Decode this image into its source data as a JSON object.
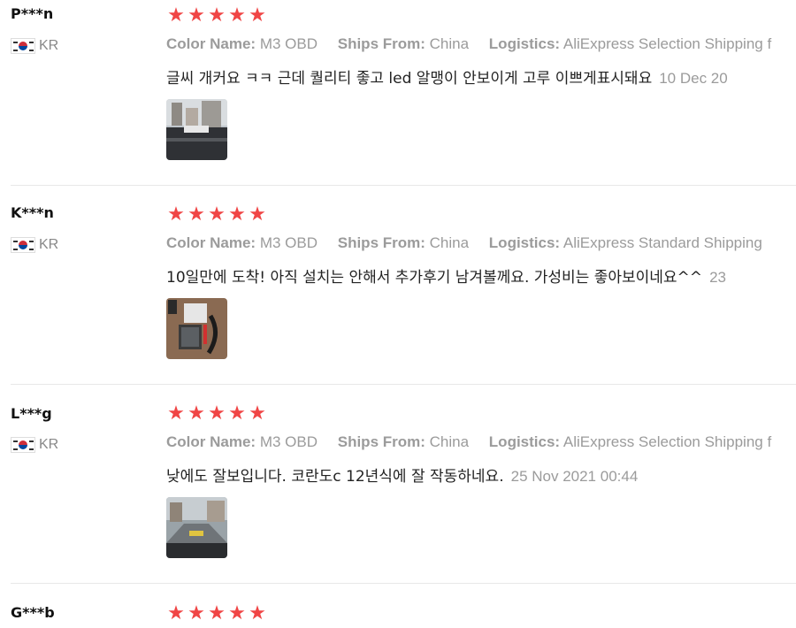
{
  "reviews": [
    {
      "user": "P***n",
      "country": "KR",
      "stars": 5,
      "attrs": [
        {
          "key": "Color Name:",
          "value": "M3 OBD"
        },
        {
          "key": "Ships From:",
          "value": "China"
        },
        {
          "key": "Logistics:",
          "value": "AliExpress Selection Shipping f"
        }
      ],
      "text": "글씨 개커요 ㅋㅋ 근데 퀄리티 좋고 led 알맹이 안보이게 고루 이쁘게표시돼요",
      "date": "10 Dec 20",
      "image": "review-photo-dashboard-hud"
    },
    {
      "user": "K***n",
      "country": "KR",
      "stars": 5,
      "attrs": [
        {
          "key": "Color Name:",
          "value": "M3 OBD"
        },
        {
          "key": "Ships From:",
          "value": "China"
        },
        {
          "key": "Logistics:",
          "value": "AliExpress Standard Shipping"
        }
      ],
      "text": "10일만에 도착! 아직 설치는 안해서 추가후기 남겨볼께요. 가성비는 좋아보이네요^^",
      "date": "23",
      "image": "review-photo-package-contents"
    },
    {
      "user": "L***g",
      "country": "KR",
      "stars": 5,
      "attrs": [
        {
          "key": "Color Name:",
          "value": "M3 OBD"
        },
        {
          "key": "Ships From:",
          "value": "China"
        },
        {
          "key": "Logistics:",
          "value": "AliExpress Selection Shipping f"
        }
      ],
      "text": "낮에도 잘보입니다. 코란도c 12년식에 잘 작동하네요.",
      "date": "25 Nov 2021 00:44",
      "image": "review-photo-road-hud"
    },
    {
      "user": "G***b",
      "country": "KR",
      "stars": 5,
      "attrs": [],
      "text": "",
      "date": "",
      "image": ""
    }
  ],
  "colors": {
    "star": "#f04545",
    "muted": "#9b9b9b",
    "text": "#222222"
  }
}
